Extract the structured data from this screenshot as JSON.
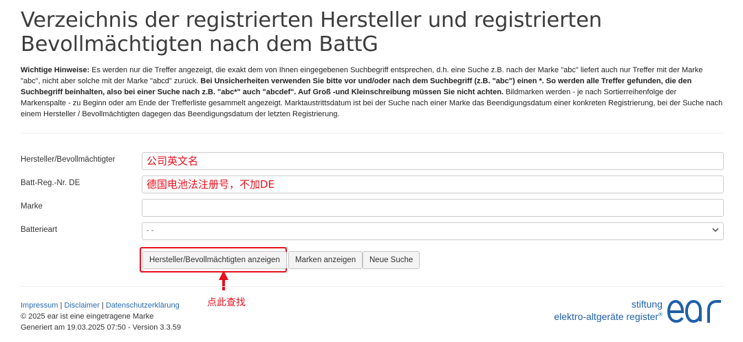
{
  "page": {
    "title": "Verzeichnis der registrierten Hersteller und registrierten Bevollmächtigten nach dem BattG"
  },
  "notes": {
    "label": "Wichtige Hinweise:",
    "text1": " Es werden nur die Treffer angezeigt, die exakt dem von Ihnen eingegebenen Suchbegriff entsprechen, d.h. eine Suche z.B. nach der Marke \"abc\" liefert auch nur Treffer mit der Marke \"abc\", nicht aber solche mit der Marke \"abcd\" zurück. ",
    "bold": "Bei Unsicherheiten verwenden Sie bitte vor und/oder nach dem Suchbegriff (z.B. \"abc\") einen *. So werden alle Treffer gefunden, die den Suchbegriff beinhalten, also bei einer Suche nach z.B. \"abc*\" auch \"abcdef\". Auf Groß -und Kleinschreibung müssen Sie nicht achten.",
    "text2": " Bildmarken werden - je nach Sortierreihenfolge der Markenspalte - zu Beginn oder am Ende der Trefferliste gesammelt angezeigt. Marktaustrittsdatum ist bei der Suche nach einer Marke das Beendigungsdatum einer konkreten Registrierung, bei der Suche nach einem Hersteller / Bevollmächtigten dagegen das Beendigungsdatum der letzten Registrierung."
  },
  "form": {
    "hersteller": {
      "label": "Hersteller/Bevollmächtigter",
      "value": "公司英文名"
    },
    "battreg": {
      "label": "Batt-Reg.-Nr. DE",
      "value": "德国电池法注册号，不加DE"
    },
    "marke": {
      "label": "Marke",
      "value": ""
    },
    "batterieart": {
      "label": "Batterieart",
      "selected": "- -"
    }
  },
  "buttons": {
    "show_manufacturers": "Hersteller/Bevollmächtigten anzeigen",
    "show_brands": "Marken anzeigen",
    "new_search": "Neue Suche"
  },
  "annotation": {
    "text": "点此查找",
    "color": "#e8101c"
  },
  "footer": {
    "impressum": "Impressum",
    "disclaimer": "Disclaimer",
    "datenschutz": "Datenschutzerklärung",
    "separator": " | ",
    "trademark": "© 2025 ear ist eine eingetragene Marke",
    "generated": "Generiert am 19.03.2025 07:50 - Version 3.3.59"
  },
  "logo": {
    "line1": "stiftung",
    "line2": "elektro-altgeräte register",
    "registered": "®",
    "mark": "ear",
    "color": "#1f5fa8"
  }
}
